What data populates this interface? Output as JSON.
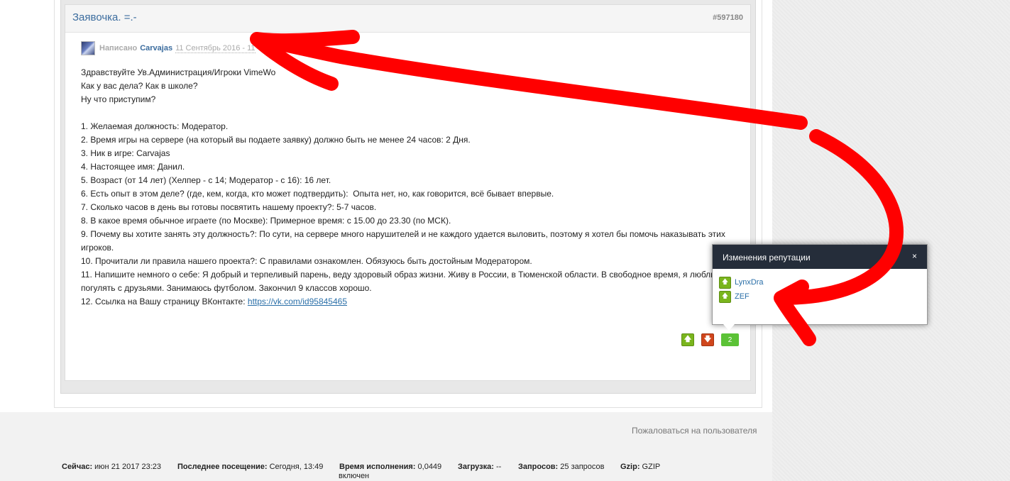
{
  "post": {
    "title": "Заявочка. =.-",
    "id": "#597180",
    "author_label": "Написано",
    "author": "Carvajas",
    "date": "11 Сентябрь 2016 - 11",
    "lines": [
      "Здравствуйте Ув.Администрация/Игроки VimeWo",
      "Как у вас дела? Как в школе?",
      "Ну что приступим?",
      "",
      "1. Желаемая должность: Модератор.",
      "2. Время игры на сервере (на который вы подаете заявку) должно быть не менее 24 часов: 2 Дня.",
      "3. Ник в игре: Carvajas",
      "4. Настоящее имя: Данил.",
      "5. Возраст (от 14 лет) (Хелпер - с 14; Модератор - с 16): 16 лет.",
      "6. Есть опыт в этом деле? (где, кем, когда, кто может подтвердить):  Опыта нет, но, как говорится, всё бывает впервые.",
      "7. Сколько часов в день вы готовы посвятить нашему проекту?: 5-7 часов.",
      "8. В какое время обычное играете (по Москве): Примерное время: с 15.00 до 23.30 (по МСК).",
      "9. Почему вы хотите занять эту должность?: По сути, на сервере много нарушителей и не каждого удается выловить, поэтому я хотел бы помочь наказывать этих игроков.",
      "10. Прочитали ли правила нашего проекта?: С правилами ознакомлен. Обязуюсь быть достойным Модератором.",
      "11. Напишите немного о себе: Я добрый и терпеливый парень, веду здоровый образ жизни. Живу в России, в Тюменской области. В свободное время, я люблю погулять с друзьями. Занимаюсь футболом. Закончил 9 классов хорошо."
    ],
    "last_line_prefix": "12. Ссылка на Вашу страницу ВКонтакте: ",
    "vk_link": "https://vk.com/id95845465",
    "rep_up": "🡅",
    "rep_down": "🡇",
    "rep_count": "2"
  },
  "report_link": "Пожаловаться на пользователя",
  "footer": {
    "now_label": "Сейчас:",
    "now_value": " июн 21 2017 23:23",
    "last_visit_label": "Последнее посещение:",
    "last_visit_value": " Сегодня, 13:49",
    "exec_label": "Время исполнения:",
    "exec_value": " 0,0449",
    "load_label": "Загрузка:",
    "load_value": " --",
    "queries_label": "Запросов:",
    "queries_value": " 25 запросов",
    "gzip_label": "Gzip:",
    "gzip_value": " GZIP",
    "gzip_sub": "включен"
  },
  "popup": {
    "title": "Изменения репутации",
    "close": "×",
    "users": [
      "LynxDra",
      "ZEF"
    ]
  },
  "colors": {
    "annotation": "#ff0000",
    "popup_header": "#252d3a",
    "link": "#2a6fa8",
    "rep_up": "#7ab51d",
    "rep_down": "#d0461c"
  }
}
